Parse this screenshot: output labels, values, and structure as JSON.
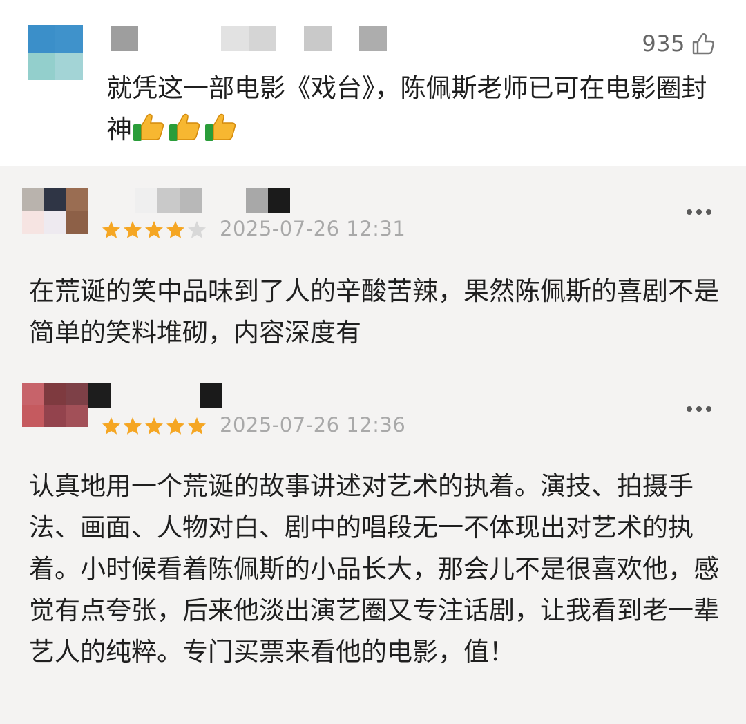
{
  "top_comment": {
    "likes": "935",
    "text": "就凭这一部电影《戏台》，陈佩斯老师已可在电影圈封神",
    "emojis": [
      "thumbs-up",
      "thumbs-up",
      "thumbs-up"
    ]
  },
  "reviews": [
    {
      "rating": 4,
      "max_rating": 5,
      "date": "2025-07-26 12:31",
      "text": "在荒诞的笑中品味到了人的辛酸苦辣，果然陈佩斯的喜剧不是简单的笑料堆砌，内容深度有"
    },
    {
      "rating": 5,
      "max_rating": 5,
      "date": "2025-07-26 12:36",
      "text": "认真地用一个荒诞的故事讲述对艺术的执着。演技、拍摄手法、画面、人物对白、剧中的唱段无一不体现出对艺术的执着。小时候看着陈佩斯的小品长大，那会儿不是很喜欢他，感觉有点夸张，后来他淡出演艺圈又专注话剧，让我看到老一辈艺人的纯粹。专门买票来看他的电影，值！"
    }
  ],
  "colors": {
    "star_filled": "#f5a623",
    "star_empty": "#d8d8d8",
    "date": "#a9a9a9",
    "top_background": "#ffffff",
    "list_background": "#f4f3f2"
  },
  "icons": {
    "like": "thumbs-up-outline-icon",
    "more": "more-dots-icon",
    "star": "star-icon"
  }
}
